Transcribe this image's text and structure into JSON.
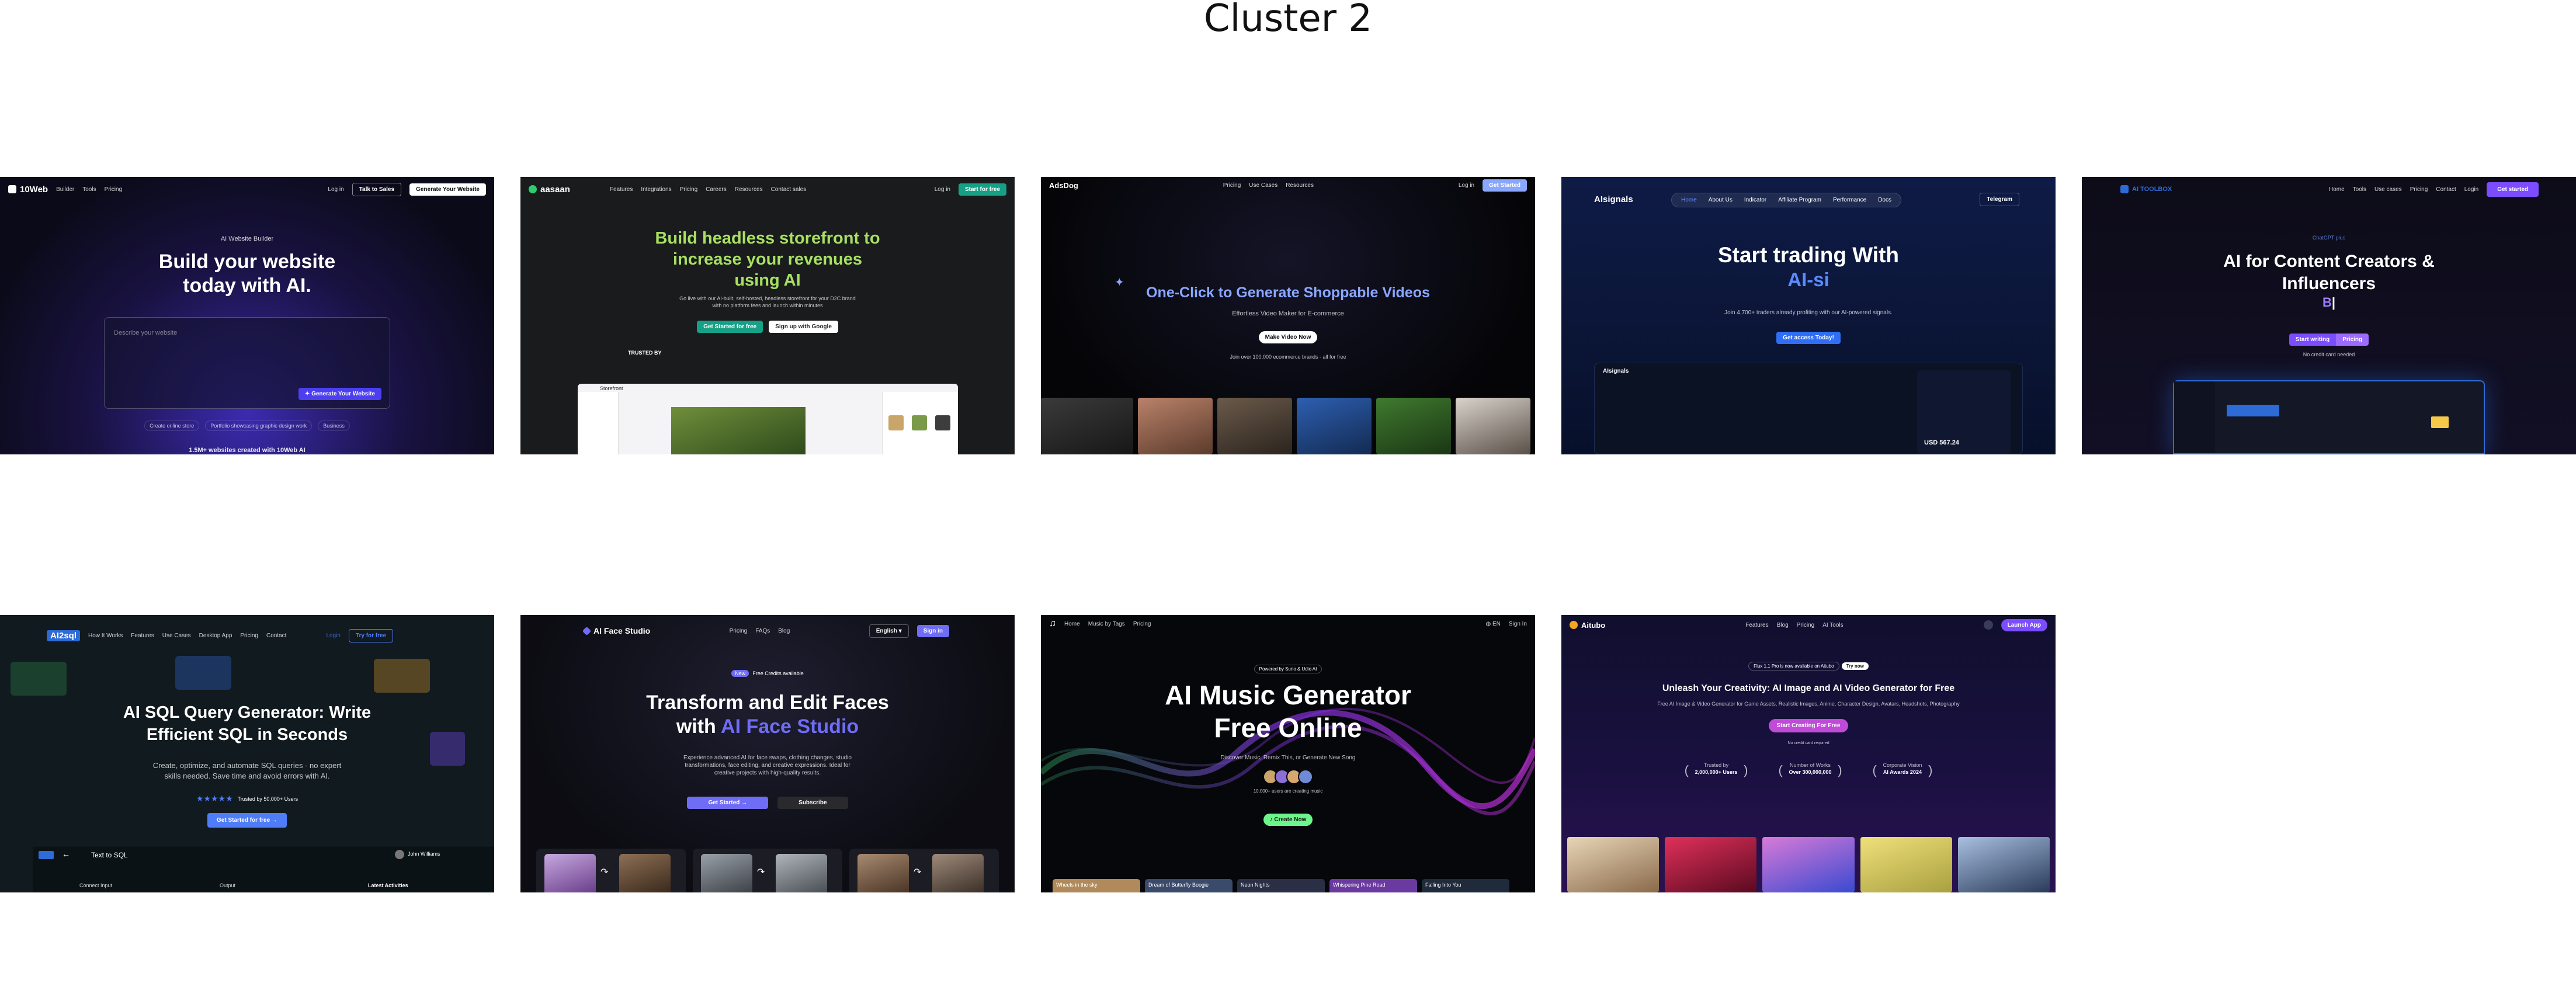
{
  "page_title": "Cluster 2",
  "thumbs": {
    "t1": {
      "logo": "10Web",
      "nav": [
        "Builder",
        "Tools",
        "Pricing"
      ],
      "login": "Log in",
      "talk_sales": "Talk to Sales",
      "cta": "Generate Your Website",
      "eyebrow": "AI Website Builder",
      "title_1": "Build your website",
      "title_2": "today with AI.",
      "prompt_placeholder": "Describe your website",
      "prompt_button": "Generate Your Website",
      "chips": [
        "Create online store",
        "Portfolio showcasing graphic design work",
        "Business"
      ],
      "footer": "1.5M+ websites created with 10Web AI"
    },
    "t2": {
      "logo": "aasaan",
      "nav": [
        "Features",
        "Integrations",
        "Pricing",
        "Careers",
        "Resources",
        "Contact sales"
      ],
      "login": "Log in",
      "cta": "Start for free",
      "title_1": "Build headless storefront to",
      "title_2": "increase your revenues",
      "title_3": "using AI",
      "sub_1": "Go live with our AI-built, self-hosted, headless storefront for your D2C brand",
      "sub_2": "with no platform fees and launch within minutes",
      "btn_primary": "Get Started for free",
      "btn_secondary": "Sign up with Google",
      "trust": "TRUSTED BY",
      "preview_title": "Storefront"
    },
    "t3": {
      "logo": "AdsDog",
      "nav": [
        "Pricing",
        "Use Cases",
        "Resources"
      ],
      "login": "Log in",
      "cta": "Get Started",
      "title": "One-Click to Generate Shoppable Videos",
      "sub": "Effortless Video Maker for E-commerce",
      "btn": "Make Video Now",
      "note": "Join over 100,000 ecommerce brands - all for free"
    },
    "t4": {
      "logo": "AIsignals",
      "nav": [
        "Home",
        "About Us",
        "Indicator",
        "Affiliate Program",
        "Performance",
        "Docs"
      ],
      "cta": "Telegram",
      "title_1": "Start trading With",
      "title_2": "AI-si",
      "sub": "Join 4,700+ traders already profiting with our AI-powered signals.",
      "btn": "Get access Today!",
      "dash_label": "AIsignals",
      "dash_price": "USD 567.24"
    },
    "t5": {
      "logo": "AI TOOLBOX",
      "nav": [
        "Home",
        "Tools",
        "Use cases",
        "Pricing",
        "Contact",
        "Login"
      ],
      "cta": "Get started",
      "eyebrow": "ChatGPT plus",
      "title_1": "AI for Content Creators &",
      "title_2": "Influencers",
      "typing": "B",
      "btn_primary": "Start writing",
      "btn_secondary": "Pricing",
      "note": "No credit card needed"
    },
    "t6": {
      "logo": "AI2sql",
      "nav": [
        "How It Works",
        "Features",
        "Use Cases",
        "Desktop App",
        "Pricing",
        "Contact"
      ],
      "login": "Login",
      "cta": "Try for free",
      "title_1": "AI SQL Query Generator: Write",
      "title_2": "Efficient SQL in Seconds",
      "sub_1": "Create, optimize, and automate SQL queries - no expert",
      "sub_2": "skills needed. Save time and avoid errors with AI.",
      "stars": "★★★★★",
      "rating": "Trusted by 50,000+ Users",
      "btn": "Get Started for free →",
      "app_title": "Text to SQL",
      "app_user": "John Williams",
      "col_1": "Connect Input",
      "col_2": "Output",
      "col_3": "Latest Activities"
    },
    "t7": {
      "logo": "AI Face Studio",
      "nav": [
        "Pricing",
        "FAQs",
        "Blog"
      ],
      "lang": "English",
      "cta": "Sign in",
      "badge_tag": "New",
      "badge": "Free Credits available",
      "title_1": "Transform and Edit Faces",
      "title_2a": "with",
      "title_2b": "AI Face Studio",
      "sub_1": "Experience advanced AI for face swaps, clothing changes, studio",
      "sub_2": "transformations, face editing, and creative expressions. Ideal for",
      "sub_3": "creative projects with high-quality results.",
      "btn_primary": "Get Started →",
      "btn_secondary": "Subscribe"
    },
    "t8": {
      "nav": [
        "Home",
        "Music by Tags",
        "Pricing"
      ],
      "lang": "EN",
      "login": "Sign In",
      "eyebrow": "Powered by Suno & Udio AI",
      "title_1": "AI Music Generator",
      "title_2": "Free Online",
      "sub": "Discover Music, Remix This, or Generate New Song",
      "users": "10,000+ users are creating music",
      "btn": "Create Now",
      "cards": [
        "Wheels in the sky",
        "Dream of Butterfly Boogie",
        "Neon Nights",
        "Whispering Pine Road",
        "Falling Into You"
      ]
    },
    "t9": {
      "logo": "Aitubo",
      "nav": [
        "Features",
        "Blog",
        "Pricing",
        "AI Tools"
      ],
      "cta": "Launch App",
      "badge": "Flux 1.1 Pro is now available on Aitubo",
      "badge_btn": "Try now",
      "title": "Unleash Your Creativity: AI Image and AI Video Generator for Free",
      "sub": "Free AI Image & Video Generator for Game Assets, Realistic Images, Anime, Character Design, Avatars, Headshots, Photography",
      "btn": "Start Creating For Free",
      "note": "No credit card required",
      "stats": [
        {
          "top": "Trusted by",
          "bottom": "2,000,000+ Users"
        },
        {
          "top": "Number of Works",
          "bottom": "Over 300,000,000"
        },
        {
          "top": "Corporate Vision",
          "bottom": "AI Awards 2024"
        }
      ]
    }
  },
  "colors": {
    "t2_accent": "#a8e063",
    "t2_button": "#16a085",
    "t3_accent": "#8aa7ff",
    "t4_accent": "#5b8cff",
    "t5_accent": "#7c4dff",
    "t6_accent": "#4f7df7",
    "t7_accent": "#6f6cf5",
    "t8_accent": "#6cf58a",
    "t9_accent": "#c04bd8"
  }
}
